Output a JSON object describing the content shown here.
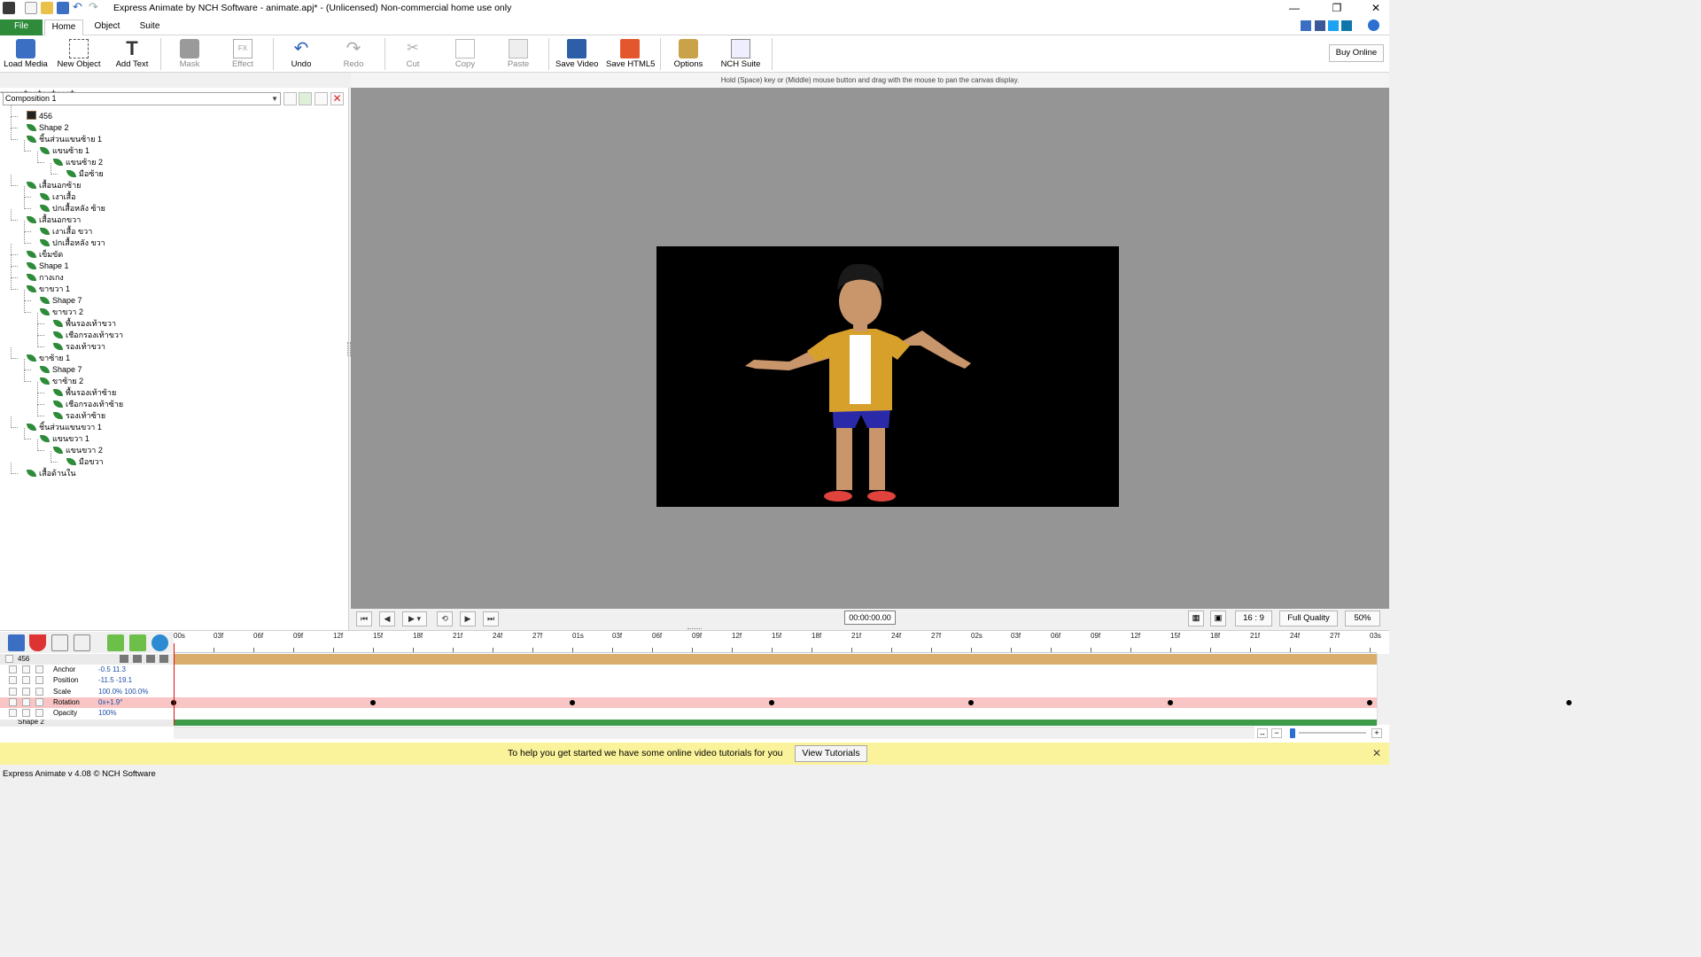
{
  "window": {
    "title": "Express Animate by NCH Software - animate.apj* - (Unlicensed) Non-commercial home use only"
  },
  "menu": {
    "tabs": [
      "File",
      "Home",
      "Object",
      "Suite"
    ],
    "active": "Home"
  },
  "ribbon": {
    "buttons": [
      {
        "label": "Load Media",
        "icon": "load-media-icon",
        "enabled": true
      },
      {
        "label": "New Object",
        "icon": "new-object-icon",
        "enabled": true
      },
      {
        "label": "Add Text",
        "icon": "add-text-icon",
        "enabled": true
      },
      {
        "label": "Mask",
        "icon": "mask-icon",
        "enabled": false
      },
      {
        "label": "Effect",
        "icon": "effect-icon",
        "enabled": false
      },
      {
        "label": "Undo",
        "icon": "undo-icon",
        "enabled": true
      },
      {
        "label": "Redo",
        "icon": "redo-icon",
        "enabled": false
      },
      {
        "label": "Cut",
        "icon": "cut-icon",
        "enabled": false
      },
      {
        "label": "Copy",
        "icon": "copy-icon",
        "enabled": false
      },
      {
        "label": "Paste",
        "icon": "paste-icon",
        "enabled": false
      },
      {
        "label": "Save Video",
        "icon": "save-video-icon",
        "enabled": true
      },
      {
        "label": "Save HTML5",
        "icon": "save-html5-icon",
        "enabled": true
      },
      {
        "label": "Options",
        "icon": "options-icon",
        "enabled": true
      },
      {
        "label": "NCH Suite",
        "icon": "nch-suite-icon",
        "enabled": true
      }
    ],
    "buy_online": "Buy Online"
  },
  "hint": "Hold (Space) key or (Middle) mouse button and drag with the mouse to pan the canvas display.",
  "composition": {
    "selected": "Composition 1",
    "tree": [
      {
        "label": "456",
        "level": 0,
        "icon": "image"
      },
      {
        "label": "Shape 2",
        "level": 0
      },
      {
        "label": "ชิ้นส่วนแขนซ้าย 1",
        "level": 0,
        "expander": "−"
      },
      {
        "label": "แขนซ้าย 1",
        "level": 1,
        "expander": "−"
      },
      {
        "label": "แขนซ้าย 2",
        "level": 2,
        "expander": "−"
      },
      {
        "label": "มือซ้าย",
        "level": 3
      },
      {
        "label": "เสื้อนอกซ้าย",
        "level": 0,
        "expander": "−"
      },
      {
        "label": "เงาเสื้อ",
        "level": 1
      },
      {
        "label": "ปกเสื้อหลัง ซ้าย",
        "level": 1
      },
      {
        "label": "เสื้อนอกขวา",
        "level": 0,
        "expander": "−"
      },
      {
        "label": "เงาเสื้อ ขวา",
        "level": 1
      },
      {
        "label": "ปกเสื้อหลัง ขวา",
        "level": 1
      },
      {
        "label": "เข็มขัด",
        "level": 0,
        "expander": "+"
      },
      {
        "label": "Shape 1",
        "level": 0
      },
      {
        "label": "กางเกง",
        "level": 0
      },
      {
        "label": "ขาขวา 1",
        "level": 0,
        "expander": "−"
      },
      {
        "label": "Shape 7",
        "level": 1
      },
      {
        "label": "ขาขวา 2",
        "level": 1,
        "expander": "−"
      },
      {
        "label": "พื้นรองเท้าขวา",
        "level": 2
      },
      {
        "label": "เชือกรองเท้าขวา",
        "level": 2
      },
      {
        "label": "รองเท้าขวา",
        "level": 2,
        "expander": "+"
      },
      {
        "label": "ขาซ้าย 1",
        "level": 0,
        "expander": "−"
      },
      {
        "label": "Shape 7",
        "level": 1
      },
      {
        "label": "ขาซ้าย 2",
        "level": 1,
        "expander": "−"
      },
      {
        "label": "พื้นรองเท้าซ้าย",
        "level": 2
      },
      {
        "label": "เชือกรองเท้าซ้าย",
        "level": 2
      },
      {
        "label": "รองเท้าซ้าย",
        "level": 2,
        "expander": "+"
      },
      {
        "label": "ชิ้นส่วนแขนขวา 1",
        "level": 0,
        "expander": "−"
      },
      {
        "label": "แขนขวา 1",
        "level": 1,
        "expander": "−"
      },
      {
        "label": "แขนขวา 2",
        "level": 2,
        "expander": "−"
      },
      {
        "label": "มือขวา",
        "level": 3
      },
      {
        "label": "เสื้อด้านใน",
        "level": 0,
        "expander": "+"
      }
    ]
  },
  "playback": {
    "timecode": "00:00:00.00",
    "aspect": "16 : 9",
    "quality": "Full Quality",
    "zoom": "50%"
  },
  "timeline": {
    "ticks": [
      "00s",
      "03f",
      "06f",
      "09f",
      "12f",
      "15f",
      "18f",
      "21f",
      "24f",
      "27f",
      "01s",
      "03f",
      "06f",
      "09f",
      "12f",
      "15f",
      "18f",
      "21f",
      "24f",
      "27f",
      "02s",
      "03f",
      "06f",
      "09f",
      "12f",
      "15f",
      "18f",
      "21f",
      "24f",
      "27f",
      "03s"
    ],
    "layer_name": "456",
    "next_layer_name": "Shape 2",
    "properties": [
      {
        "name": "Anchor",
        "value": "-0.5  11.3"
      },
      {
        "name": "Position",
        "value": "-11.5  -19.1"
      },
      {
        "name": "Scale",
        "value": "100.0%  100.0%"
      },
      {
        "name": "Rotation",
        "value": "0x+1.9°"
      },
      {
        "name": "Opacity",
        "value": "100%"
      }
    ],
    "rotation_keyframes": [
      0,
      5,
      10,
      15,
      20,
      25,
      30,
      35,
      40
    ]
  },
  "tutorial": {
    "text": "To help you get started we have some online video tutorials for you",
    "button": "View Tutorials"
  },
  "status": "Express Animate v 4.08 © NCH Software",
  "colors": {
    "file_tab": "#2e8b3a",
    "layer_bar": "#d9ad6c",
    "rotation_track": "#f8c4c4",
    "green_track": "#3c9a48",
    "tutorial_bg": "#fbf39b"
  }
}
